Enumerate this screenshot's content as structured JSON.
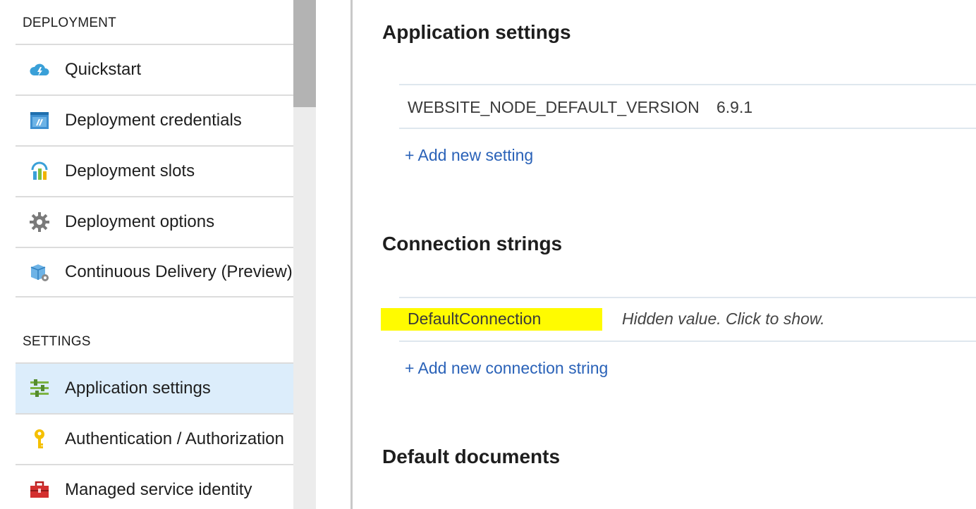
{
  "sidebar": {
    "deployment_header": "DEPLOYMENT",
    "settings_header": "SETTINGS",
    "deployment_items": [
      {
        "label": "Quickstart",
        "icon": "cloud-lightning-icon"
      },
      {
        "label": "Deployment credentials",
        "icon": "credentials-icon"
      },
      {
        "label": "Deployment slots",
        "icon": "slots-icon"
      },
      {
        "label": "Deployment options",
        "icon": "gear-icon"
      },
      {
        "label": "Continuous Delivery (Preview)",
        "icon": "box-icon"
      }
    ],
    "settings_items": [
      {
        "label": "Application settings",
        "icon": "sliders-icon",
        "active": true
      },
      {
        "label": "Authentication / Authorization",
        "icon": "key-icon"
      },
      {
        "label": "Managed service identity",
        "icon": "toolbox-icon"
      }
    ]
  },
  "main": {
    "app_settings": {
      "title": "Application settings",
      "rows": [
        {
          "name": "WEBSITE_NODE_DEFAULT_VERSION",
          "value": "6.9.1"
        }
      ],
      "add_link": "+ Add new setting"
    },
    "connection_strings": {
      "title": "Connection strings",
      "rows": [
        {
          "name": "DefaultConnection",
          "value": "Hidden value. Click to show."
        }
      ],
      "add_link": "+ Add new connection string"
    },
    "default_documents": {
      "title": "Default documents"
    }
  },
  "colors": {
    "active_bg": "#dcedfb",
    "link": "#2a62b8",
    "highlight": "#fffb00"
  }
}
